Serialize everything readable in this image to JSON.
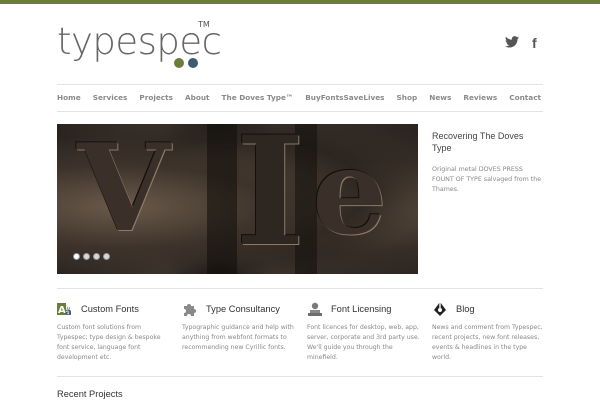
{
  "logo": {
    "text": "typespec",
    "tm": "TM"
  },
  "social": {
    "twitter": "twitter-icon",
    "facebook": "f"
  },
  "nav": [
    "Home",
    "Services",
    "Projects",
    "About",
    "The Doves Type™",
    "BuyFontsSaveLives",
    "Shop",
    "News",
    "Reviews",
    "Contact"
  ],
  "slider": {
    "caption_title": "Recovering The Doves Type",
    "caption_text": "Original metal DOVES PRESS FOUNT OF TYPE salvaged from the Thames.",
    "dots": 4,
    "active_dot": 1
  },
  "features": [
    {
      "icon": "fonts-icon",
      "title": "Custom Fonts",
      "text": "Custom font solutions from Typespec; type design & bespoke font service, language font development etc."
    },
    {
      "icon": "puzzle-icon",
      "title": "Type Consultancy",
      "text": "Typographic guidance and help with anything from webfont formats to recommending new Cyrillic fonts."
    },
    {
      "icon": "license-icon",
      "title": "Font Licensing",
      "text": "Font licences for desktop, web, app, server, corporate and 3rd party use. We'll guide you through the minefield."
    },
    {
      "icon": "blog-icon",
      "title": "Blog",
      "text": "News and comment from Typespec, recent projects, new font releases, events & headlines in the type world."
    }
  ],
  "recent": {
    "title": "Recent Projects"
  },
  "colors": {
    "accent": "#6b7d3b",
    "dot_blue": "#3d5a6e"
  }
}
